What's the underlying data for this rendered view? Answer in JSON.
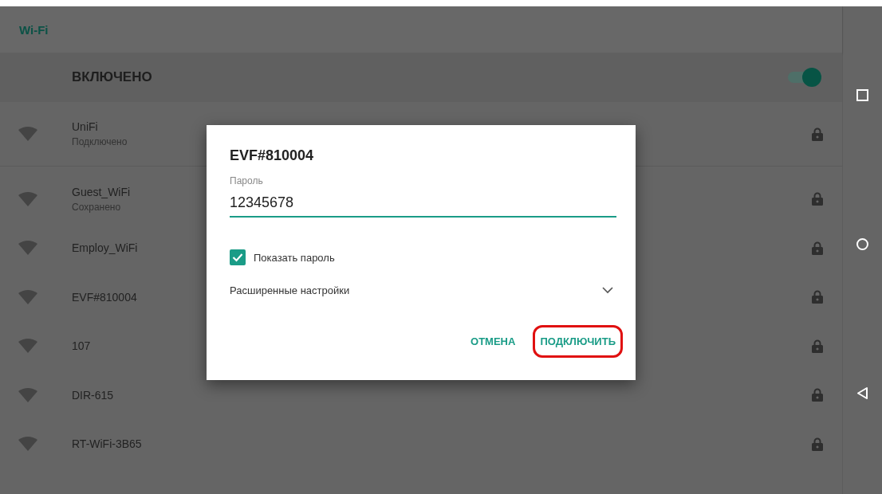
{
  "app_bar": {
    "title": "Wi-Fi"
  },
  "master_switch": {
    "label": "ВКЛЮЧЕНО",
    "on": true
  },
  "networks": [
    {
      "name": "UniFi",
      "status": "Подключено",
      "secured": true
    },
    {
      "name": "Guest_WiFi",
      "status": "Сохранено",
      "secured": true
    },
    {
      "name": "Employ_WiFi",
      "secured": true
    },
    {
      "name": "EVF#810004",
      "secured": true
    },
    {
      "name": "107",
      "secured": true
    },
    {
      "name": "DIR-615",
      "secured": true
    },
    {
      "name": "RT-WiFi-3B65",
      "secured": true
    }
  ],
  "dialog": {
    "title": "EVF#810004",
    "field_label": "Пароль",
    "password": "12345678",
    "show_password": {
      "label": "Показать пароль",
      "checked": true
    },
    "advanced": {
      "label": "Расширенные настройки",
      "expanded": false
    },
    "buttons": [
      {
        "label": "ОТМЕНА",
        "highlighted": false
      },
      {
        "label": "ПОДКЛЮЧИТЬ",
        "highlighted": true
      }
    ]
  },
  "nav_bar": {
    "buttons": [
      {
        "kind": "recents"
      },
      {
        "kind": "home"
      },
      {
        "kind": "back"
      }
    ]
  }
}
